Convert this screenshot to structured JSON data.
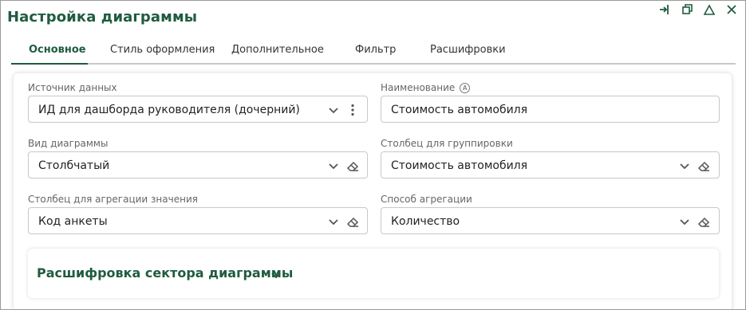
{
  "window": {
    "title": "Настройка диаграммы",
    "controls": [
      "login-icon",
      "restore-icon",
      "home-icon",
      "close-icon"
    ]
  },
  "tabs": [
    {
      "label": "Основное",
      "active": true
    },
    {
      "label": "Стиль оформления",
      "active": false
    },
    {
      "label": "Дополнительное",
      "active": false
    },
    {
      "label": "Фильтр",
      "active": false
    },
    {
      "label": "Расшифровки",
      "active": false
    }
  ],
  "form": {
    "data_source": {
      "label": "Источник данных",
      "value": "ИД для дашборда руководителя (дочерний)"
    },
    "name": {
      "label": "Наименование",
      "info": "A",
      "value": "Стоимость автомобиля"
    },
    "chart_type": {
      "label": "Вид диаграммы",
      "value": "Столбчатый"
    },
    "group_column": {
      "label": "Столбец для группировки",
      "value": "Стоимость автомобиля"
    },
    "agg_column": {
      "label": "Столбец для агрегации значения",
      "value": "Код анкеты"
    },
    "agg_method": {
      "label": "Способ агрегации",
      "value": "Количество"
    }
  },
  "drilldown": {
    "title": "Расшифровка сектора диаграммы"
  },
  "colors": {
    "accent": "#1f5c3f",
    "border": "#c8c8c8"
  }
}
